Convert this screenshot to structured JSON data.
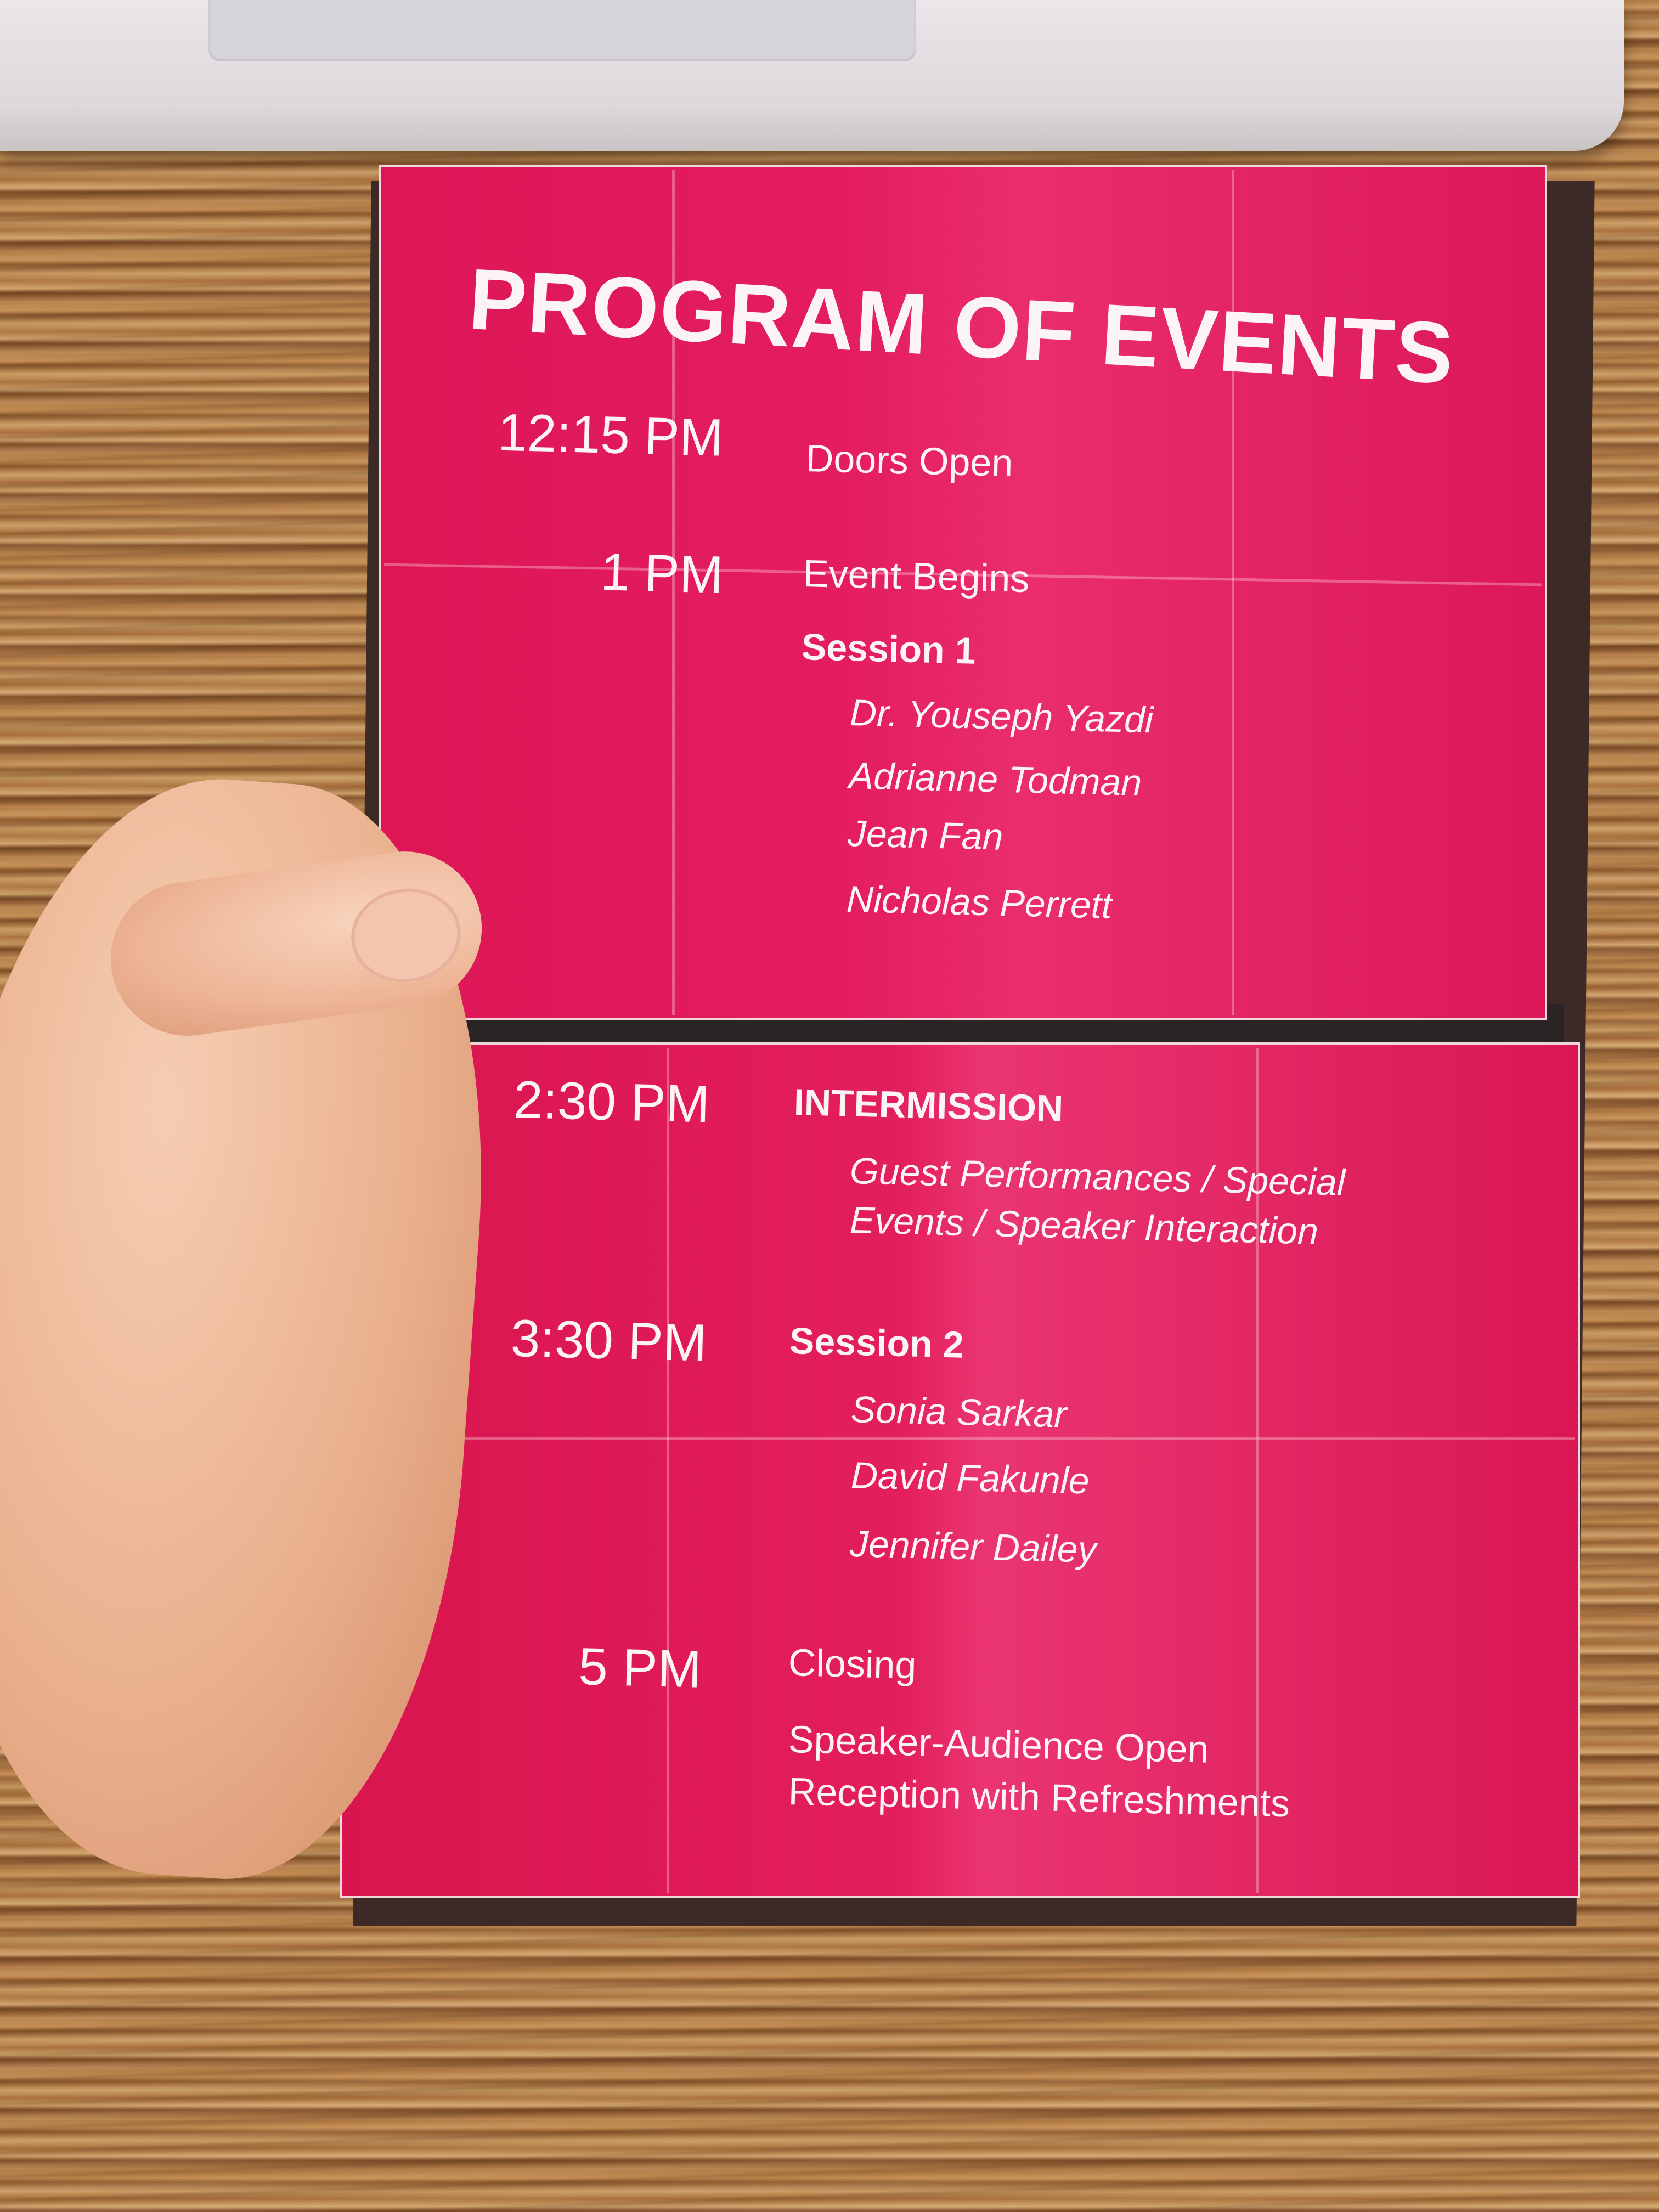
{
  "program": {
    "title": "PROGRAM OF EVENTS",
    "schedule": [
      {
        "time": "12:15 PM",
        "event": "Doors Open"
      },
      {
        "time": "1 PM",
        "event": "Event Begins"
      },
      {
        "time": "2:30 PM",
        "event": "INTERMISSION"
      },
      {
        "time": "3:30 PM",
        "event": "Session 2"
      },
      {
        "time": "5 PM",
        "event": "Closing"
      }
    ],
    "session1": {
      "label": "Session 1",
      "speakers": [
        "Dr. Youseph Yazdi",
        "Adrianne Todman",
        "Jean Fan",
        "Nicholas Perrett"
      ]
    },
    "intermission_detail": [
      "Guest Performances / Special",
      "Events / Speaker Interaction"
    ],
    "session2_speakers": [
      "Sonia Sarkar",
      "David Fakunle",
      "Jennifer Dailey"
    ],
    "closing_detail": [
      "Speaker-Audience Open",
      "Reception with Refreshments"
    ]
  }
}
